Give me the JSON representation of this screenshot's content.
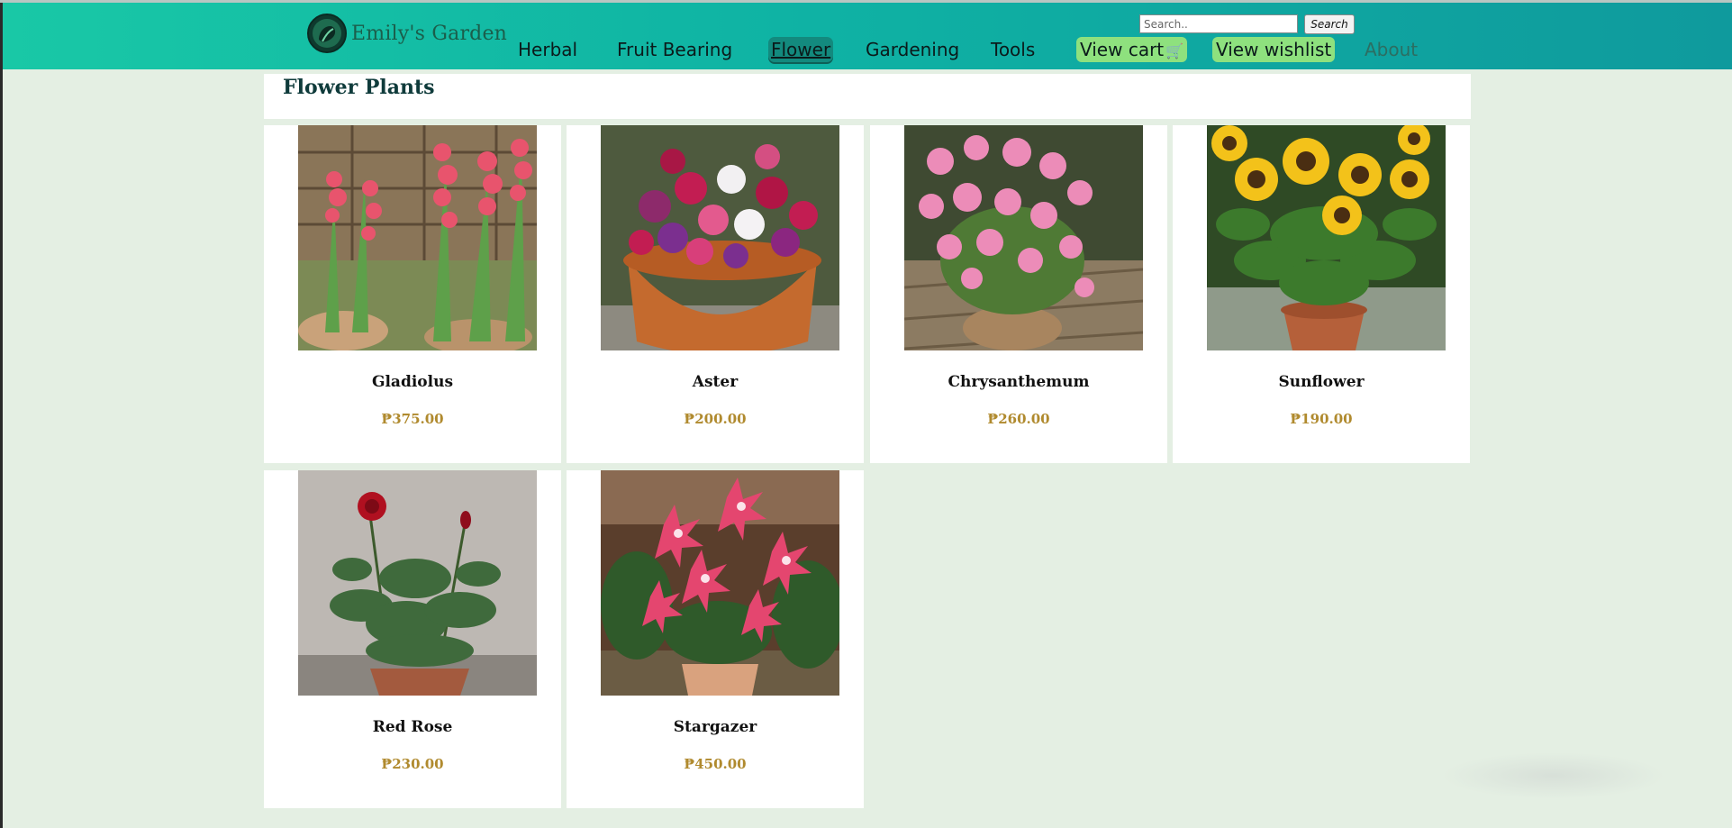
{
  "brand": {
    "name": "Emily's Garden"
  },
  "search": {
    "placeholder": "Search..",
    "button_label": "Search"
  },
  "nav": {
    "items": [
      {
        "label": "Herbal"
      },
      {
        "label": "Fruit Bearing"
      },
      {
        "label": "Flower",
        "active": true
      },
      {
        "label": "Gardening"
      },
      {
        "label": "Tools"
      },
      {
        "label": "View cart",
        "icon": "cart-icon"
      },
      {
        "label": "View wishlist"
      },
      {
        "label": "About"
      }
    ]
  },
  "page": {
    "title": "Flower Plants"
  },
  "products": [
    {
      "name": "Gladiolus",
      "price": "₱375.00",
      "image": "gladiolus-plant-photo"
    },
    {
      "name": "Aster",
      "price": "₱200.00",
      "image": "aster-pot-photo"
    },
    {
      "name": "Chrysanthemum",
      "price": "₱260.00",
      "image": "chrysanthemum-pot-photo"
    },
    {
      "name": "Sunflower",
      "price": "₱190.00",
      "image": "sunflower-pot-photo"
    },
    {
      "name": "Red Rose",
      "price": "₱230.00",
      "image": "red-rose-pot-photo"
    },
    {
      "name": "Stargazer",
      "price": "₱450.00",
      "image": "stargazer-lily-photo"
    }
  ],
  "colors": {
    "header_start": "#19c8a6",
    "header_end": "#0f9a9d",
    "page_bg": "#e4efe3",
    "price": "#b08a2e",
    "nav_pill": "#8ee17e",
    "nav_active": "#138a7e"
  }
}
